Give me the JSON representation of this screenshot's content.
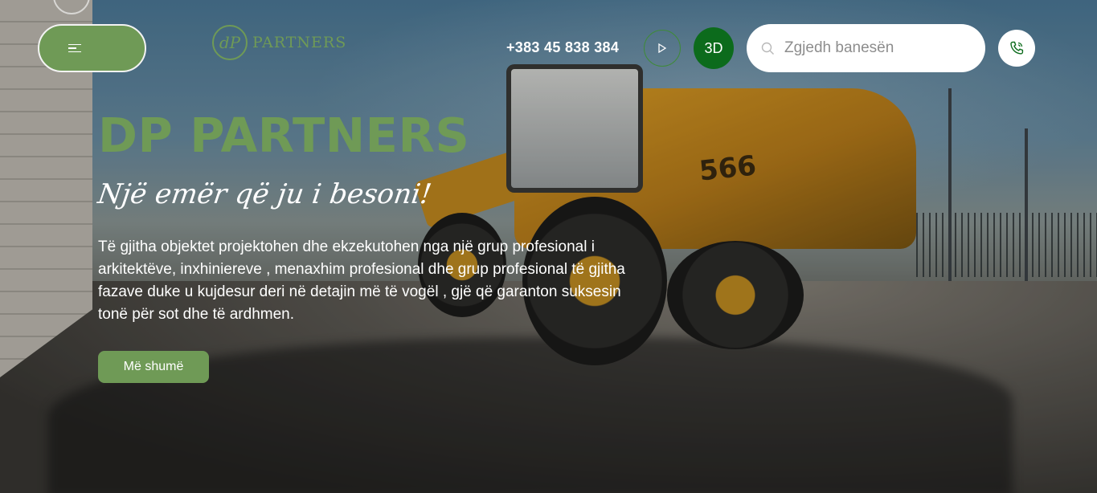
{
  "header": {
    "logo_mark": "dP",
    "logo_text": "PARTNERS",
    "phone": "+383 45 838 384",
    "btn_3d": "3D",
    "search": {
      "placeholder": "Zgjedh banesën"
    }
  },
  "hero": {
    "title": "DP PARTNERS",
    "tagline": "Një emër që ju i besoni!",
    "description": "Të gjitha objektet projektohen dhe ekzekutohen nga një grup profesional i arkitektëve, inxhiniereve , menaxhim profesional dhe grup profesional të gjitha fazave duke u kujdesur deri në detajin më të vogël , gjë që garanton suksesin tonë për sot dhe të ardhmen.",
    "button": "Më shumë",
    "machine_number": "566"
  },
  "colors": {
    "brand_green": "#6f9a56",
    "dark_green": "#0c6b1c",
    "white": "#ffffff"
  },
  "icons": [
    "menu-icon",
    "play-icon",
    "search-icon",
    "phone-call-icon"
  ]
}
